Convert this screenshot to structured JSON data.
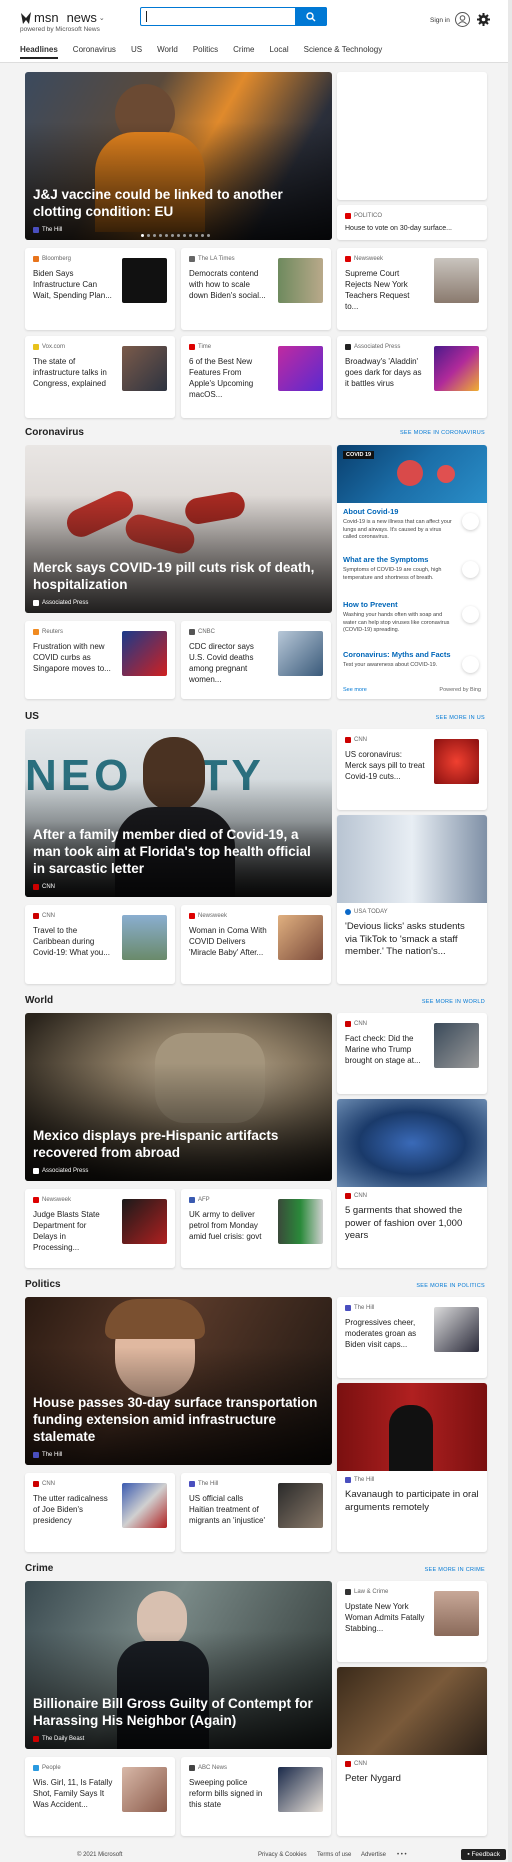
{
  "header": {
    "brand": "msn",
    "section": "news",
    "powered": "powered by Microsoft News",
    "signin": "Sign in"
  },
  "nav": [
    "Headlines",
    "Coronavirus",
    "US",
    "World",
    "Politics",
    "Crime",
    "Local",
    "Science & Technology"
  ],
  "headlines": {
    "hero": {
      "title": "J&J vaccine could be linked to another clotting condition: EU",
      "source": "The Hill"
    },
    "side": {
      "source": "POLITICO",
      "title": "House to vote on 30-day surface..."
    },
    "row1": [
      {
        "source": "Bloomberg",
        "title": "Biden Says Infrastructure Can Wait, Spending Plan..."
      },
      {
        "source": "The LA Times",
        "title": "Democrats contend with how to scale down Biden's social..."
      },
      {
        "source": "Newsweek",
        "title": "Supreme Court Rejects New York Teachers Request to..."
      }
    ],
    "row2": [
      {
        "source": "Vox.com",
        "title": "The state of infrastructure talks in Congress, explained"
      },
      {
        "source": "Time",
        "title": "6 of the Best New Features From Apple's Upcoming macOS..."
      },
      {
        "source": "Associated Press",
        "title": "Broadway's 'Aladdin' goes dark for days as it battles virus"
      }
    ]
  },
  "coronavirus": {
    "title": "Coronavirus",
    "see_more": "SEE MORE IN CORONAVIRUS",
    "hero": {
      "title": "Merck says COVID-19 pill cuts risk of death, hospitalization",
      "source": "Associated Press"
    },
    "panel": {
      "badge": "COVID 19",
      "items": [
        {
          "h": "About Covid-19",
          "p": "Covid-19 is a new illness that can affect your lungs and airways. It's caused by a virus called coronavirus."
        },
        {
          "h": "What are the Symptoms",
          "p": "Symptoms of COVID-19 are cough, high temperature and shortness of breath."
        },
        {
          "h": "How to Prevent",
          "p": "Washing your hands often with soap and water can help stop viruses like coronavirus (COVID-19) spreading."
        },
        {
          "h": "Coronavirus: Myths and Facts",
          "p": "Test your awareness about COVID-19."
        }
      ],
      "see_more": "See more",
      "powered": "Powered by Bing"
    },
    "row": [
      {
        "source": "Reuters",
        "title": "Frustration with new COVID curbs as Singapore moves to..."
      },
      {
        "source": "CNBC",
        "title": "CDC director says U.S. Covid deaths among pregnant women..."
      }
    ]
  },
  "us": {
    "title": "US",
    "see_more": "SEE MORE IN US",
    "hero": {
      "title": "After a family member died of Covid-19, a man took aim at Florida's top health official in sarcastic letter",
      "source": "CNN",
      "sign": "NEO CITY"
    },
    "side": {
      "source": "CNN",
      "title": "US coronavirus: Merck says pill to treat Covid-19 cuts..."
    },
    "tall": {
      "source": "USA TODAY",
      "title": "'Devious licks' asks students via TikTok to 'smack a staff member.' The nation's..."
    },
    "row": [
      {
        "source": "CNN",
        "title": "Travel to the Caribbean during Covid-19: What you..."
      },
      {
        "source": "Newsweek",
        "title": "Woman in Coma With COVID Delivers 'Miracle Baby' After..."
      }
    ]
  },
  "world": {
    "title": "World",
    "see_more": "SEE MORE IN WORLD",
    "hero": {
      "title": "Mexico displays pre-Hispanic artifacts recovered from abroad",
      "source": "Associated Press"
    },
    "side": {
      "source": "CNN",
      "title": "Fact check: Did the Marine who Trump brought on stage at..."
    },
    "tall": {
      "source": "CNN",
      "title": "5 garments that showed the power of fashion over 1,000 years"
    },
    "row": [
      {
        "source": "Newsweek",
        "title": "Judge Blasts State Department for Delays in Processing..."
      },
      {
        "source": "AFP",
        "title": "UK army to deliver petrol from Monday amid fuel crisis: govt"
      }
    ]
  },
  "politics": {
    "title": "Politics",
    "see_more": "SEE MORE IN POLITICS",
    "hero": {
      "title": "House passes 30-day surface transportation funding extension amid infrastructure stalemate",
      "source": "The Hill"
    },
    "side": {
      "source": "The Hill",
      "title": "Progressives cheer, moderates groan as Biden visit caps..."
    },
    "tall": {
      "source": "The Hill",
      "title": "Kavanaugh to participate in oral arguments remotely"
    },
    "row": [
      {
        "source": "CNN",
        "title": "The utter radicalness of Joe Biden's presidency"
      },
      {
        "source": "The Hill",
        "title": "US official calls Haitian treatment of migrants an 'injustice'"
      }
    ]
  },
  "crime": {
    "title": "Crime",
    "see_more": "SEE MORE IN CRIME",
    "hero": {
      "title": "Billionaire Bill Gross Guilty of Contempt for Harassing His Neighbor (Again)",
      "source": "The Daily Beast"
    },
    "side": {
      "source": "Law & Crime",
      "title": "Upstate New York Woman Admits Fatally Stabbing..."
    },
    "tall": {
      "source": "CNN",
      "title": "Peter Nygard"
    },
    "row": [
      {
        "source": "People",
        "title": "Wis. Girl, 11, Is Fatally Shot, Family Says It Was Accident..."
      },
      {
        "source": "ABC News",
        "title": "Sweeping police reform bills signed in this state"
      }
    ]
  },
  "footer": {
    "copyright": "© 2021 Microsoft",
    "privacy": "Privacy & Cookies",
    "terms": "Terms of use",
    "advertise": "Advertise",
    "more": "• • •",
    "feedback": "Feedback"
  }
}
